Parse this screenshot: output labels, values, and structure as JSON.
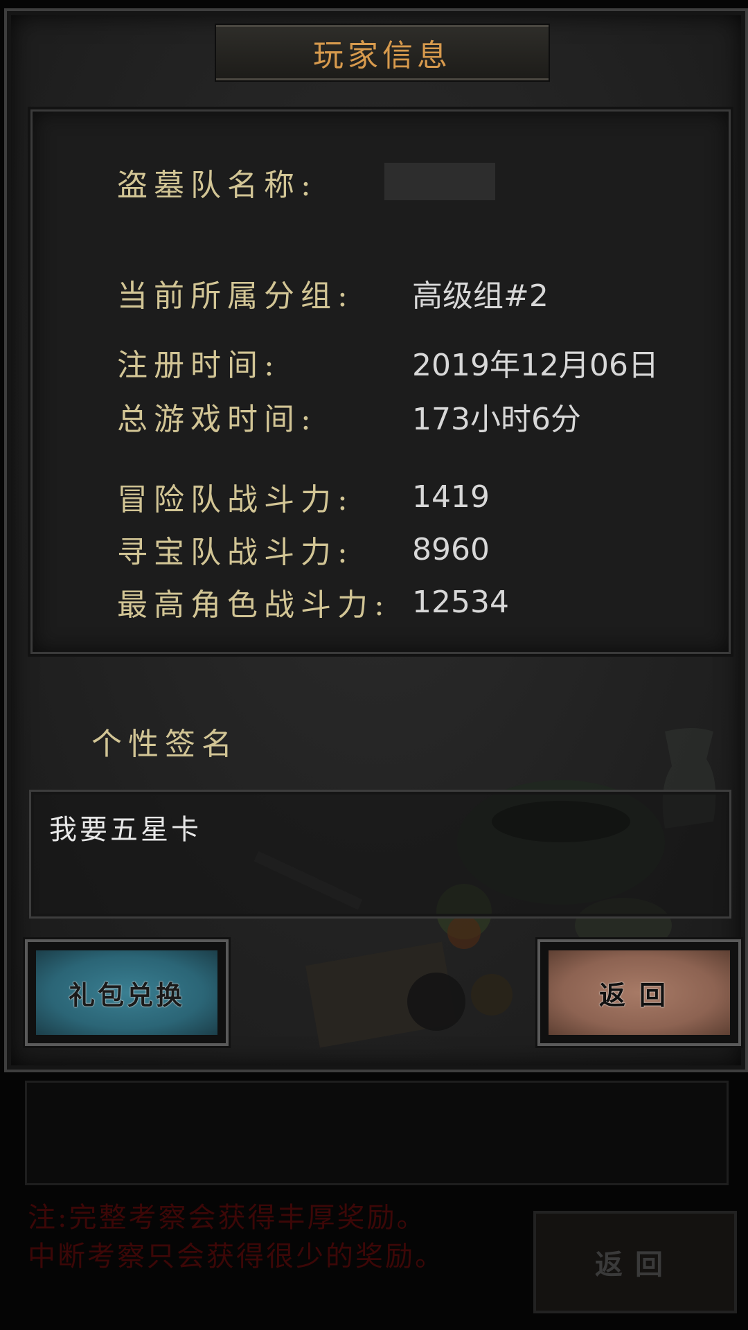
{
  "dialog": {
    "title": "玩家信息"
  },
  "info": {
    "team_name_label": "盗墓队名称:",
    "group_label": "当前所属分组:",
    "group_value": "高级组#2",
    "register_label": "注册时间:",
    "register_value": "2019年12月06日",
    "playtime_label": "总游戏时间:",
    "playtime_value": "173小时6分",
    "adventure_label": "冒险队战斗力:",
    "adventure_value": "1419",
    "treasure_label": "寻宝队战斗力:",
    "treasure_value": "8960",
    "top_label": "最高角色战斗力:",
    "top_value": "12534"
  },
  "signature": {
    "label": "个性签名",
    "text": "我要五星卡"
  },
  "buttons": {
    "gift": "礼包兑换",
    "back": "返回"
  },
  "background": {
    "note_line1": "注:完整考察会获得丰厚奖励。",
    "note_line2": "中断考察只会获得很少的奖励。",
    "back_button": "返回"
  },
  "colors": {
    "title": "#d79a4d",
    "label": "#d2c595",
    "value": "#d8d8d8",
    "gift_button": "#2b6576",
    "back_button": "#8d6352"
  }
}
